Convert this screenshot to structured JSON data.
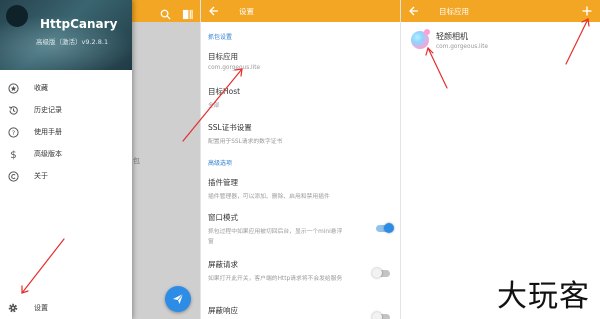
{
  "drawer": {
    "app_title": "HttpCanary",
    "version": "高级版（激活）v9.2.8.1",
    "items": [
      {
        "label": "收藏",
        "icon": "star-circle-icon"
      },
      {
        "label": "历史记录",
        "icon": "history-icon"
      },
      {
        "label": "使用手册",
        "icon": "help-circle-icon"
      },
      {
        "label": "高级版本",
        "icon": "dollar-icon"
      },
      {
        "label": "关于",
        "icon": "copyright-icon"
      }
    ],
    "settings_label": "设置",
    "behind_text": "包"
  },
  "settings": {
    "title": "设置",
    "section_capture": "抓包设置",
    "target_app": {
      "title": "目标应用",
      "sub": "com.gorgeous.lite"
    },
    "target_host": {
      "title": "目标Host",
      "sub": "全部"
    },
    "ssl": {
      "title": "SSL证书设置",
      "sub": "配置用于SSL请求的数字证书"
    },
    "section_advanced": "高级选项",
    "plugin": {
      "title": "插件管理",
      "sub": "插件管理器，可以添加、删除、启用和禁用插件"
    },
    "window_mode": {
      "title": "窗口模式",
      "sub1": "抓包过程中如果应用被切回后台，显示一个mini悬浮",
      "sub2": "窗",
      "enabled": true
    },
    "block_request": {
      "title": "屏蔽请求",
      "sub": "如果打开此开关，客户端的Http请求将不会发给服务",
      "enabled": false
    },
    "block_response": {
      "title": "屏蔽响应",
      "enabled": false
    }
  },
  "targets": {
    "title": "目标应用",
    "items": [
      {
        "name": "轻颜相机",
        "package": "com.gorgeous.lite"
      }
    ]
  },
  "watermark": "大玩客",
  "colors": {
    "accent": "#f3a524",
    "primary_blue": "#2d8ce6",
    "arrow_red": "#e52d2d"
  }
}
